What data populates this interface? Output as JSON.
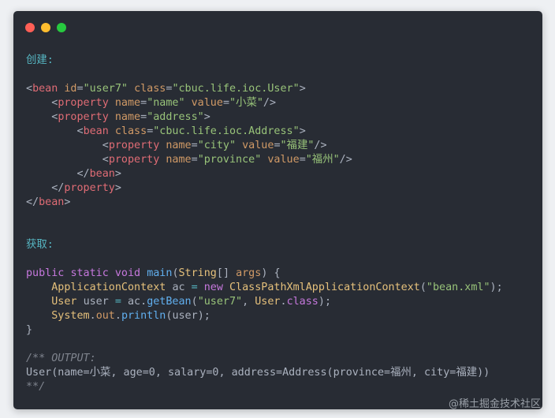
{
  "window": {
    "traffic_lights": [
      {
        "name": "close",
        "color": "#ff5f56"
      },
      {
        "name": "minimize",
        "color": "#ffbd2e"
      },
      {
        "name": "maximize",
        "color": "#27c93f"
      }
    ]
  },
  "code": {
    "create_label": "创建:",
    "xml_bean_user_open": "<bean id=\"user7\" class=\"cbuc.life.ioc.User\">",
    "xml_prop_name": "    <property name=\"name\" value=\"小菜\"/>",
    "xml_prop_address_open": "    <property name=\"address\">",
    "xml_bean_address_open": "        <bean class=\"cbuc.life.ioc.Address\">",
    "xml_prop_city": "            <property name=\"city\" value=\"福建\"/>",
    "xml_prop_province": "            <property name=\"province\" value=\"福州\"/>",
    "xml_bean_address_close": "        </bean>",
    "xml_prop_address_close": "    </property>",
    "xml_bean_user_close": "</bean>",
    "get_label": "获取:",
    "java_main": "public static void main(String[] args) {",
    "java_ctx": "    ApplicationContext ac = new ClassPathXmlApplicationContext(\"bean.xml\");",
    "java_getbean": "    User user = ac.getBean(\"user7\", User.class);",
    "java_print": "    System.out.println(user);",
    "java_close": "}",
    "output_open": "/** OUTPUT:",
    "output_value": "User(name=小菜, age=0, salary=0, address=Address(province=福州, city=福建))",
    "output_close": "**/"
  },
  "watermark": "@稀土掘金技术社区",
  "colors": {
    "background": "#282c34",
    "comment": "#56b6c2",
    "tag": "#e06c75",
    "attribute": "#d19a66",
    "string": "#98c379",
    "keyword": "#c678dd",
    "function": "#61afef",
    "type": "#e5c07b"
  }
}
